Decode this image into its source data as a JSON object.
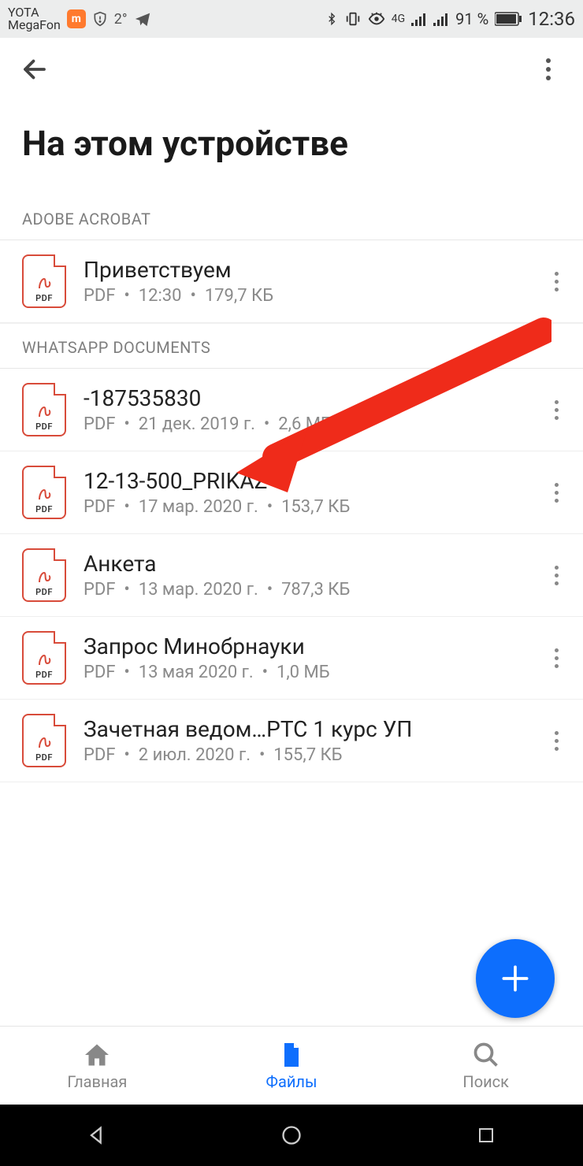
{
  "status": {
    "carrier1": "YOTA",
    "carrier2": "MegaFon",
    "temp": "2°",
    "battery": "91 %",
    "time": "12:36",
    "net": "4G"
  },
  "header": {
    "title": "На этом устройстве"
  },
  "sections": [
    {
      "label": "ADOBE ACROBAT"
    },
    {
      "label": "WHATSAPP DOCUMENTS"
    }
  ],
  "files_a": [
    {
      "name": "Приветствуем",
      "type": "PDF",
      "date": "12:30",
      "size": "179,7 КБ",
      "icon_label": "PDF"
    }
  ],
  "files_b": [
    {
      "name": "-187535830",
      "type": "PDF",
      "date": "21 дек. 2019 г.",
      "size": "2,6 МБ",
      "icon_label": "PDF"
    },
    {
      "name": "12-13-500_PRIKAZ",
      "type": "PDF",
      "date": "17 мар. 2020 г.",
      "size": "153,7 КБ",
      "icon_label": "PDF"
    },
    {
      "name": "Анкета",
      "type": "PDF",
      "date": "13 мар. 2020 г.",
      "size": "787,3 КБ",
      "icon_label": "PDF"
    },
    {
      "name": "Запрос Минобрнауки",
      "type": "PDF",
      "date": "13 мая 2020 г.",
      "size": "1,0 МБ",
      "icon_label": "PDF"
    },
    {
      "name": "Зачетная ведом…РТС 1 курс УП",
      "type": "PDF",
      "date": "2 июл. 2020 г.",
      "size": "155,7 КБ",
      "icon_label": "PDF"
    }
  ],
  "tabs": {
    "home": "Главная",
    "files": "Файлы",
    "search": "Поиск"
  },
  "fab": {
    "label": "+"
  }
}
